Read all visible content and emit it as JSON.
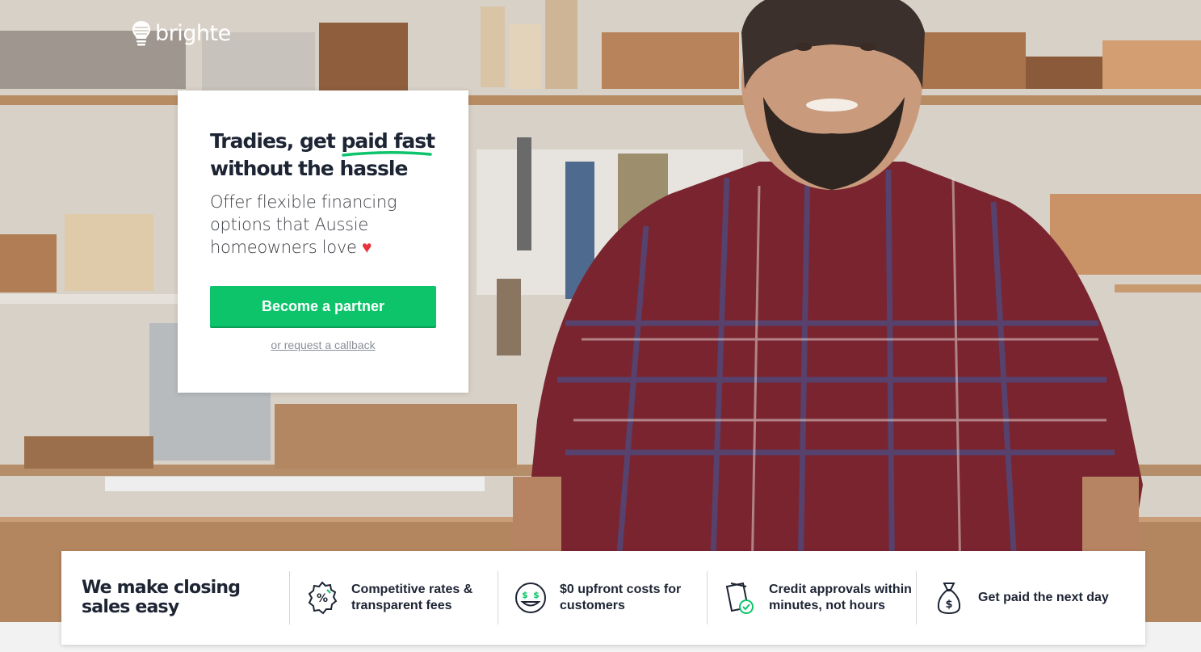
{
  "brand": {
    "name": "brighte",
    "logo_icon": "lightbulb-icon"
  },
  "hero": {
    "headline_part1": "Tradies, get ",
    "headline_highlight": "paid fast",
    "headline_part2": "without the hassle",
    "subtext": "Offer flexible financing options that Aussie homeowners love",
    "heart": "♥",
    "cta_label": "Become a partner",
    "callback_link": "or request a callback"
  },
  "benefits": {
    "title": "We make closing sales easy",
    "items": [
      {
        "icon": "percent-badge-icon",
        "label": "Competitive rates & transparent fees"
      },
      {
        "icon": "money-smile-icon",
        "label": "$0 upfront costs for customers"
      },
      {
        "icon": "approved-document-icon",
        "label": "Credit approvals within minutes, not hours"
      },
      {
        "icon": "money-bag-icon",
        "label": "Get paid the next day"
      }
    ]
  },
  "colors": {
    "accent": "#0ec46b",
    "heading": "#1d2433",
    "heart": "#e8333b"
  }
}
